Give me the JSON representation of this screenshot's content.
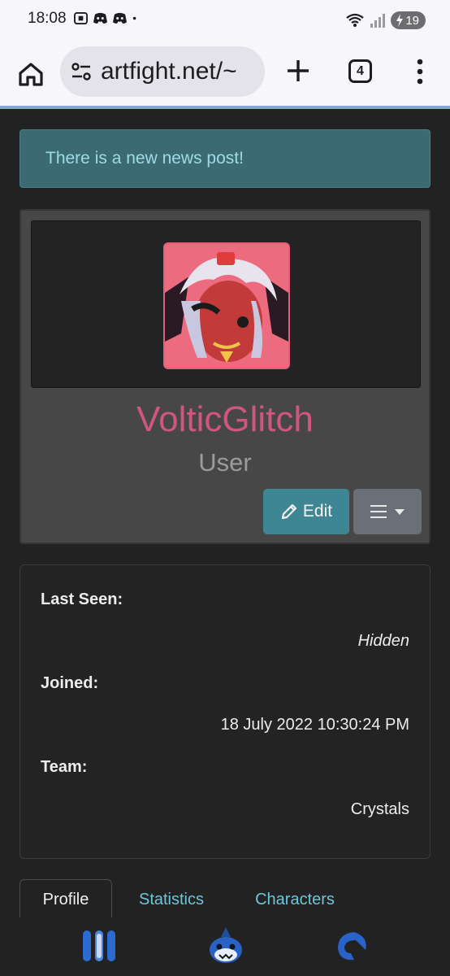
{
  "status_bar": {
    "time": "18:08",
    "left_icons": [
      "screenshot-icon",
      "discord-icon",
      "discord-icon",
      "dot-icon"
    ],
    "battery": "19"
  },
  "browser": {
    "url": "artfight.net/~",
    "tab_count": "4"
  },
  "alert": {
    "text": "There is a new news post!"
  },
  "profile": {
    "username": "VolticGlitch",
    "role": "User",
    "edit_label": "Edit",
    "username_color": "#d0567d"
  },
  "info": {
    "last_seen_label": "Last Seen:",
    "last_seen_value": "Hidden",
    "joined_label": "Joined:",
    "joined_value": "18 July 2022 10:30:24 PM",
    "team_label": "Team:",
    "team_value": "Crystals"
  },
  "tabs": [
    {
      "label": "Profile",
      "active": true
    },
    {
      "label": "Statistics",
      "active": false
    },
    {
      "label": "Characters",
      "active": false
    }
  ],
  "colors": {
    "accent_link": "#6cc7d8",
    "edit_button": "#3f8694",
    "alert_bg": "#3b6a72"
  }
}
